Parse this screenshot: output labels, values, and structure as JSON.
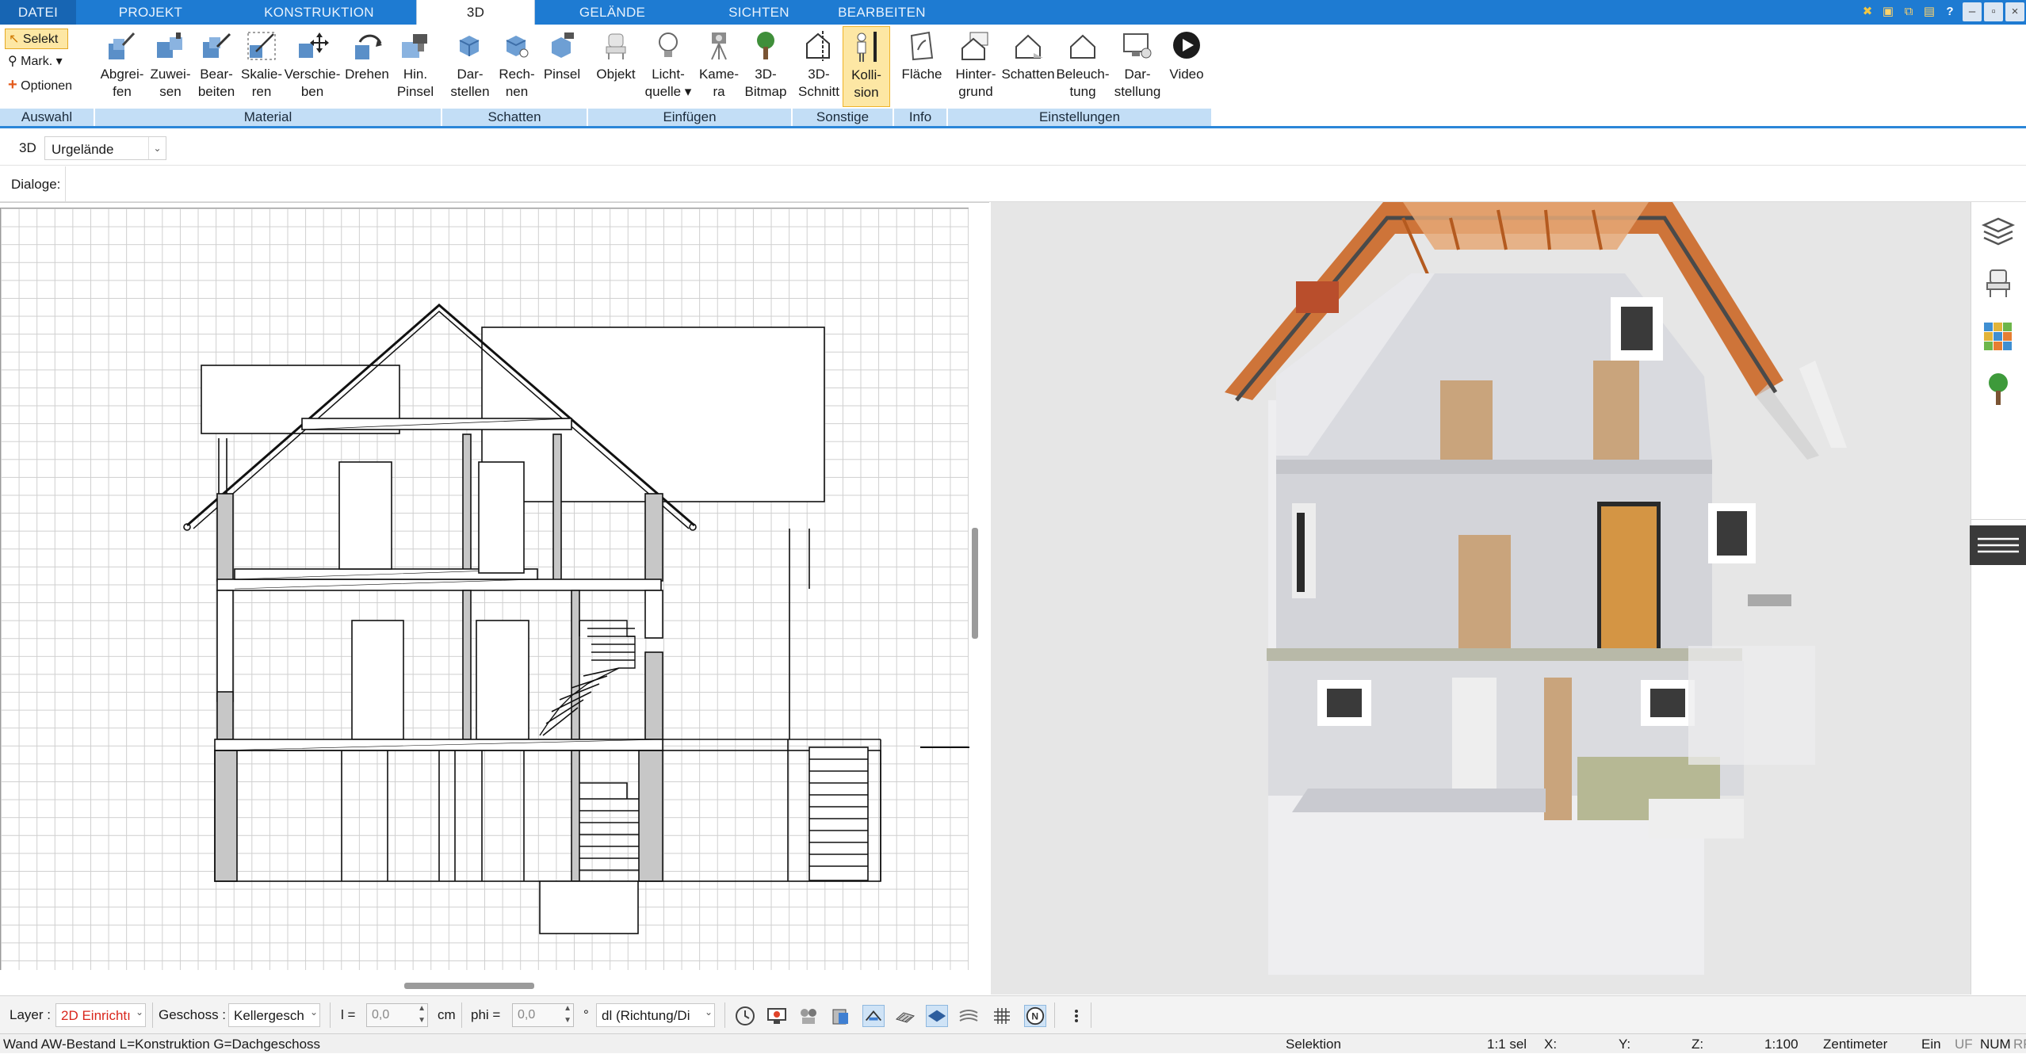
{
  "menu": {
    "tabs": [
      "DATEI",
      "PROJEKT",
      "KONSTRUKTION",
      "3D",
      "GELÄNDE",
      "SICHTEN",
      "BEARBEITEN"
    ],
    "active": "3D"
  },
  "ribbon": {
    "auswahl": {
      "select": "Selekt",
      "mark": "Mark.",
      "options": "Optionen",
      "group": "Auswahl"
    },
    "material": {
      "group": "Material",
      "buttons": [
        {
          "l1": "Abgrei-",
          "l2": "fen",
          "icon": "eyedropper-icon"
        },
        {
          "l1": "Zuwei-",
          "l2": "sen",
          "icon": "assign-material-icon"
        },
        {
          "l1": "Bear-",
          "l2": "beiten",
          "icon": "edit-material-icon"
        },
        {
          "l1": "Skalie-",
          "l2": "ren",
          "icon": "scale-icon"
        },
        {
          "l1": "Verschie-",
          "l2": "ben",
          "icon": "move-icon"
        },
        {
          "l1": "Drehen",
          "l2": "",
          "icon": "rotate-icon"
        },
        {
          "l1": "Hin.",
          "l2": "Pinsel",
          "icon": "brush-icon"
        }
      ]
    },
    "schatten": {
      "group": "Schatten",
      "buttons": [
        {
          "l1": "Dar-",
          "l2": "stellen",
          "icon": "shadow-show-icon"
        },
        {
          "l1": "Rech-",
          "l2": "nen",
          "icon": "shadow-compute-icon"
        },
        {
          "l1": "Pinsel",
          "l2": "",
          "icon": "shadow-brush-icon"
        }
      ]
    },
    "einfuegen": {
      "group": "Einfügen",
      "buttons": [
        {
          "l1": "Objekt",
          "l2": "",
          "icon": "chair-icon"
        },
        {
          "l1": "Licht-",
          "l2": "quelle ▾",
          "icon": "bulb-icon"
        },
        {
          "l1": "Kame-",
          "l2": "ra",
          "icon": "camera-icon"
        },
        {
          "l1": "3D-",
          "l2": "Bitmap",
          "icon": "tree-icon"
        }
      ]
    },
    "sonstige": {
      "group": "Sonstige",
      "buttons": [
        {
          "l1": "3D-",
          "l2": "Schnitt",
          "icon": "section-cut-icon"
        },
        {
          "l1": "Kolli-",
          "l2": "sion",
          "icon": "collision-icon"
        }
      ]
    },
    "info": {
      "group": "Info",
      "buttons": [
        {
          "l1": "Fläche",
          "l2": "",
          "icon": "area-icon"
        }
      ]
    },
    "einstellungen": {
      "group": "Einstellungen",
      "buttons": [
        {
          "l1": "Hinter-",
          "l2": "grund",
          "icon": "background-icon"
        },
        {
          "l1": "Schatten",
          "l2": "",
          "icon": "house-shadow-icon"
        },
        {
          "l1": "Beleuch-",
          "l2": "tung",
          "icon": "lighting-icon"
        },
        {
          "l1": "Dar-",
          "l2": "stellung",
          "icon": "display-icon"
        },
        {
          "l1": "Video",
          "l2": "",
          "icon": "video-play-icon"
        }
      ]
    }
  },
  "toolbar3d": {
    "label": "3D",
    "dropdown": "Urgelände"
  },
  "dialoge": {
    "label": "Dialoge:"
  },
  "bottom": {
    "layer_label": "Layer :",
    "layer_value": "2D Einrichtı",
    "geschoss_label": "Geschoss :",
    "geschoss_value": "Kellergesch",
    "l_label": "l =",
    "l_value": "0,0",
    "l_unit": "cm",
    "phi_label": "phi =",
    "phi_value": "0,0",
    "phi_unit": "°",
    "dl_value": "dl (Richtung/Di",
    "colors": {
      "layer_text": "#d9261c"
    }
  },
  "status": {
    "left": "Wand AW-Bestand L=Konstruktion G=Dachgeschoss",
    "mode": "Selektion",
    "sel": "1:1 sel",
    "x": "X:",
    "y": "Y:",
    "z": "Z:",
    "scale": "1:100",
    "unit": "Zentimeter",
    "ein": "Ein",
    "uf": "UF",
    "num": "NUM",
    "rf": "RF"
  }
}
